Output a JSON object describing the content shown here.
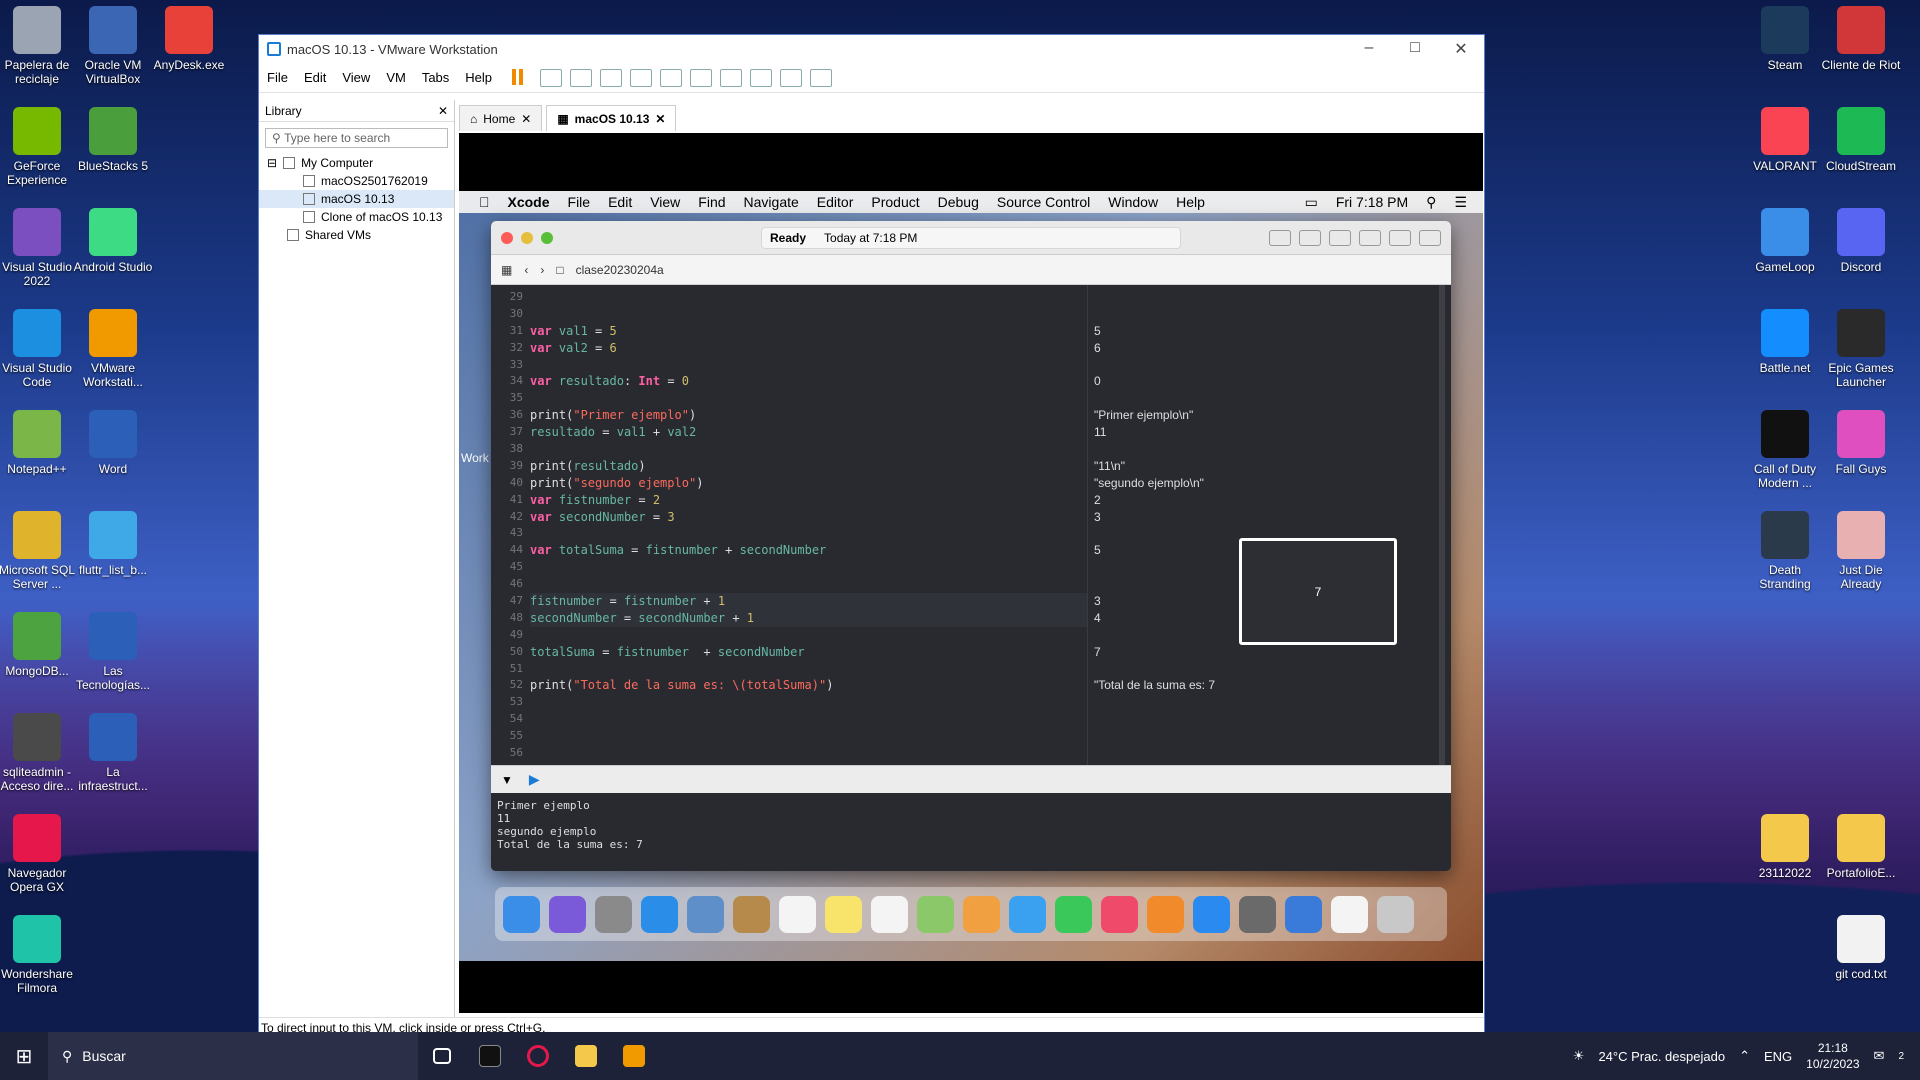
{
  "desktop_left": [
    {
      "label": "Papelera de reciclaje",
      "icon": "recycle-bin-icon",
      "color": "#9aa4b3"
    },
    {
      "label": "Oracle VM VirtualBox",
      "icon": "virtualbox-icon",
      "color": "#3b66b3"
    },
    {
      "label": "AnyDesk.exe",
      "icon": "anydesk-icon",
      "color": "#e8413a"
    },
    {
      "label": "GeForce Experience",
      "icon": "geforce-icon",
      "color": "#76b900"
    },
    {
      "label": "BlueStacks 5",
      "icon": "bluestacks-icon",
      "color": "#4a9e3c"
    },
    {
      "label": "Visual Studio 2022",
      "icon": "visual-studio-icon",
      "color": "#7b4fc0"
    },
    {
      "label": "Android Studio",
      "icon": "android-studio-icon",
      "color": "#3ddc84"
    },
    {
      "label": "Visual Studio Code",
      "icon": "vscode-icon",
      "color": "#1c8fe0"
    },
    {
      "label": "VMware Workstati...",
      "icon": "vmware-icon",
      "color": "#f09a00"
    },
    {
      "label": "Notepad++",
      "icon": "notepad-plus-icon",
      "color": "#7ab648"
    },
    {
      "label": "Word",
      "icon": "word-icon",
      "color": "#2b5fb8"
    },
    {
      "label": "Microsoft SQL Server ...",
      "icon": "sql-server-icon",
      "color": "#e0b32c"
    },
    {
      "label": "fluttr_list_b...",
      "icon": "flutter-icon",
      "color": "#3fa9e8"
    },
    {
      "label": "MongoDB...",
      "icon": "mongodb-icon",
      "color": "#4da33f"
    },
    {
      "label": "Las Tecnologías...",
      "icon": "word-doc-icon",
      "color": "#2b5fb8"
    },
    {
      "label": "sqliteadmin - Acceso dire...",
      "icon": "sqliteadmin-icon",
      "color": "#4a4a4a"
    },
    {
      "label": "La infraestruct...",
      "icon": "word-doc-icon",
      "color": "#2b5fb8"
    },
    {
      "label": "Navegador Opera GX",
      "icon": "opera-gx-icon",
      "color": "#e6184b"
    },
    {
      "label": "Wondershare Filmora",
      "icon": "filmora-icon",
      "color": "#1fc3a8"
    }
  ],
  "desktop_right": [
    {
      "label": "Steam",
      "icon": "steam-icon",
      "color": "#1b3a5c"
    },
    {
      "label": "Cliente de Riot",
      "icon": "riot-icon",
      "color": "#d13639"
    },
    {
      "label": "VALORANT",
      "icon": "valorant-icon",
      "color": "#fa4454"
    },
    {
      "label": "CloudStream",
      "icon": "cloudstream-icon",
      "color": "#1db954"
    },
    {
      "label": "GameLoop",
      "icon": "gameloop-icon",
      "color": "#3a8ee8"
    },
    {
      "label": "Discord",
      "icon": "discord-icon",
      "color": "#5865f2"
    },
    {
      "label": "Battle.net",
      "icon": "battlenet-icon",
      "color": "#148eff"
    },
    {
      "label": "Epic Games Launcher",
      "icon": "epic-games-icon",
      "color": "#2a2a2a"
    },
    {
      "label": "Call of Duty Modern ...",
      "icon": "call-of-duty-icon",
      "color": "#111111"
    },
    {
      "label": "Fall Guys",
      "icon": "fall-guys-icon",
      "color": "#e04fc0"
    },
    {
      "label": "Death Stranding",
      "icon": "death-stranding-icon",
      "color": "#2a3a4a"
    },
    {
      "label": "Just Die Already",
      "icon": "just-die-already-icon",
      "color": "#e8b0b0"
    },
    {
      "label": "23112022",
      "icon": "folder-icon",
      "color": "#f4c84a"
    },
    {
      "label": "PortafolioE...",
      "icon": "folder-icon",
      "color": "#f4c84a"
    },
    {
      "label": "git cod.txt",
      "icon": "text-file-icon",
      "color": "#f2f2f2"
    }
  ],
  "vmware": {
    "title": "macOS 10.13 - VMware Workstation",
    "menu": [
      "File",
      "Edit",
      "View",
      "VM",
      "Tabs",
      "Help"
    ],
    "library_title": "Library",
    "search_placeholder": "Type here to search",
    "tree": {
      "root": "My Computer",
      "items": [
        "macOS2501762019",
        "macOS 10.13",
        "Clone of macOS 10.13"
      ],
      "shared": "Shared VMs"
    },
    "tabs": [
      "Home",
      "macOS 10.13"
    ],
    "status": "To direct input to this VM, click inside or press Ctrl+G."
  },
  "mac": {
    "menubar": [
      "Xcode",
      "File",
      "Edit",
      "View",
      "Find",
      "Navigate",
      "Editor",
      "Product",
      "Debug",
      "Source Control",
      "Window",
      "Help"
    ],
    "clock": "Fri 7:18 PM",
    "activity_status": "Ready",
    "activity_time": "Today at 7:18 PM",
    "breadcrumb": "clase20230204a",
    "work_label": "Work"
  },
  "code_lines": [
    {
      "n": "29",
      "code": "",
      "result": ""
    },
    {
      "n": "30",
      "code": "",
      "result": ""
    },
    {
      "n": "31",
      "code": "var val1 = 5",
      "result": "5"
    },
    {
      "n": "32",
      "code": "var val2 = 6",
      "result": "6"
    },
    {
      "n": "33",
      "code": "",
      "result": ""
    },
    {
      "n": "34",
      "code": "var resultado: Int = 0",
      "result": "0"
    },
    {
      "n": "35",
      "code": "",
      "result": ""
    },
    {
      "n": "36",
      "code": "print(\"Primer ejemplo\")",
      "result": "\"Primer ejemplo\\n\""
    },
    {
      "n": "37",
      "code": "resultado = val1 + val2",
      "result": "11"
    },
    {
      "n": "38",
      "code": "",
      "result": ""
    },
    {
      "n": "39",
      "code": "print(resultado)",
      "result": "\"11\\n\""
    },
    {
      "n": "40",
      "code": "print(\"segundo ejemplo\")",
      "result": "\"segundo ejemplo\\n\""
    },
    {
      "n": "41",
      "code": "var fistnumber = 2",
      "result": "2"
    },
    {
      "n": "42",
      "code": "var secondNumber = 3",
      "result": "3"
    },
    {
      "n": "43",
      "code": "",
      "result": ""
    },
    {
      "n": "44",
      "code": "var totalSuma = fistnumber + secondNumber",
      "result": "5"
    },
    {
      "n": "45",
      "code": "",
      "result": ""
    },
    {
      "n": "46",
      "code": "",
      "result": ""
    },
    {
      "n": "47",
      "code": "fistnumber = fistnumber + 1",
      "result": "3"
    },
    {
      "n": "48",
      "code": "secondNumber = secondNumber + 1",
      "result": "4"
    },
    {
      "n": "49",
      "code": "",
      "result": ""
    },
    {
      "n": "50",
      "code": "totalSuma = fistnumber  + secondNumber",
      "result": "7"
    },
    {
      "n": "51",
      "code": "",
      "result": ""
    },
    {
      "n": "52",
      "code": "print(\"Total de la suma es: \\(totalSuma)\")",
      "result": "\"Total de la suma es: 7"
    },
    {
      "n": "53",
      "code": "",
      "result": ""
    },
    {
      "n": "54",
      "code": "",
      "result": ""
    },
    {
      "n": "55",
      "code": "",
      "result": ""
    },
    {
      "n": "56",
      "code": "",
      "result": ""
    }
  ],
  "quicklook_value": "7",
  "console_output": [
    "Primer ejemplo",
    "11",
    "segundo ejemplo",
    "Total de la suma es: 7"
  ],
  "taskbar": {
    "search_placeholder": "Buscar",
    "weather": "24°C  Prac. despejado",
    "lang": "ENG",
    "time": "21:18",
    "date": "10/2/2023",
    "notification_count": "2"
  }
}
